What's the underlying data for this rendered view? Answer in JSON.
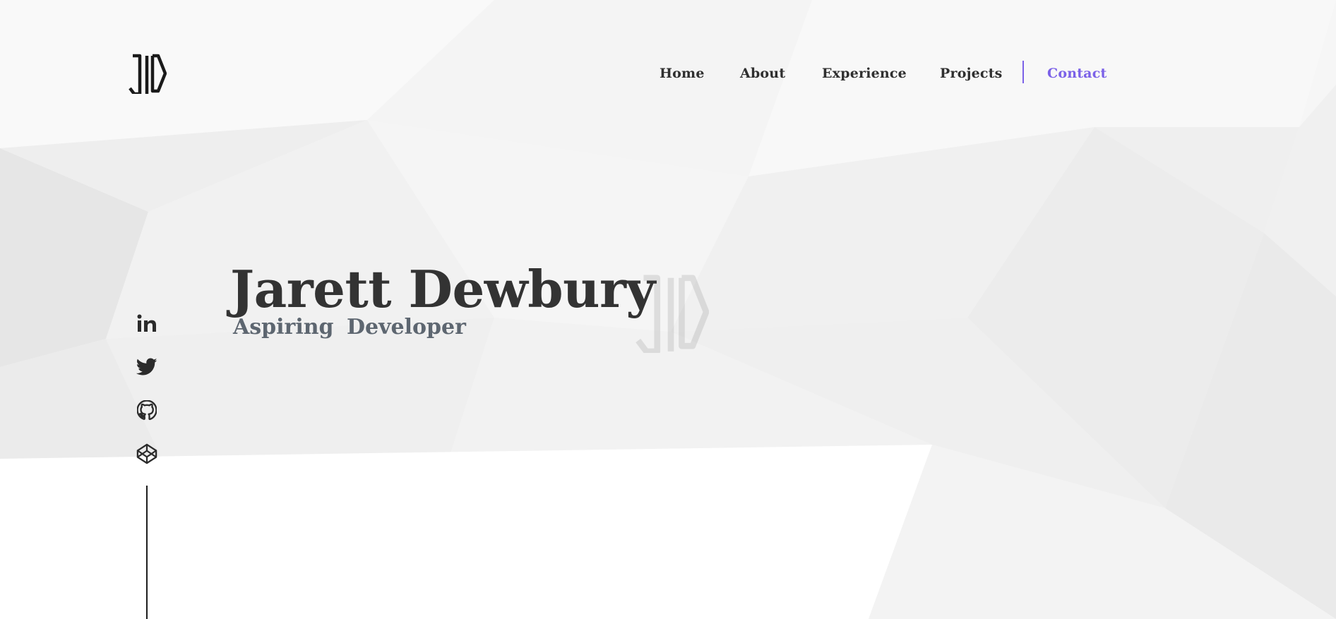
{
  "brand": {
    "logo_icon": "jd-monogram-logo",
    "watermark_icon": "jd-monogram-watermark"
  },
  "nav": {
    "items": [
      {
        "label": "Home",
        "active": false
      },
      {
        "label": "About",
        "active": false
      },
      {
        "label": "Experience",
        "active": false
      },
      {
        "label": "Projects",
        "active": false
      },
      {
        "label": "Contact",
        "active": true
      }
    ],
    "accent_color": "#7b61e8",
    "text_color": "#2f2f2f"
  },
  "hero": {
    "name": "Jarett Dewbury",
    "subtitle": "Aspiring Developer",
    "name_color": "#333333",
    "subtitle_color": "#5d6670"
  },
  "social": [
    {
      "icon": "linkedin-icon"
    },
    {
      "icon": "twitter-icon"
    },
    {
      "icon": "github-icon"
    },
    {
      "icon": "codepen-icon"
    }
  ]
}
